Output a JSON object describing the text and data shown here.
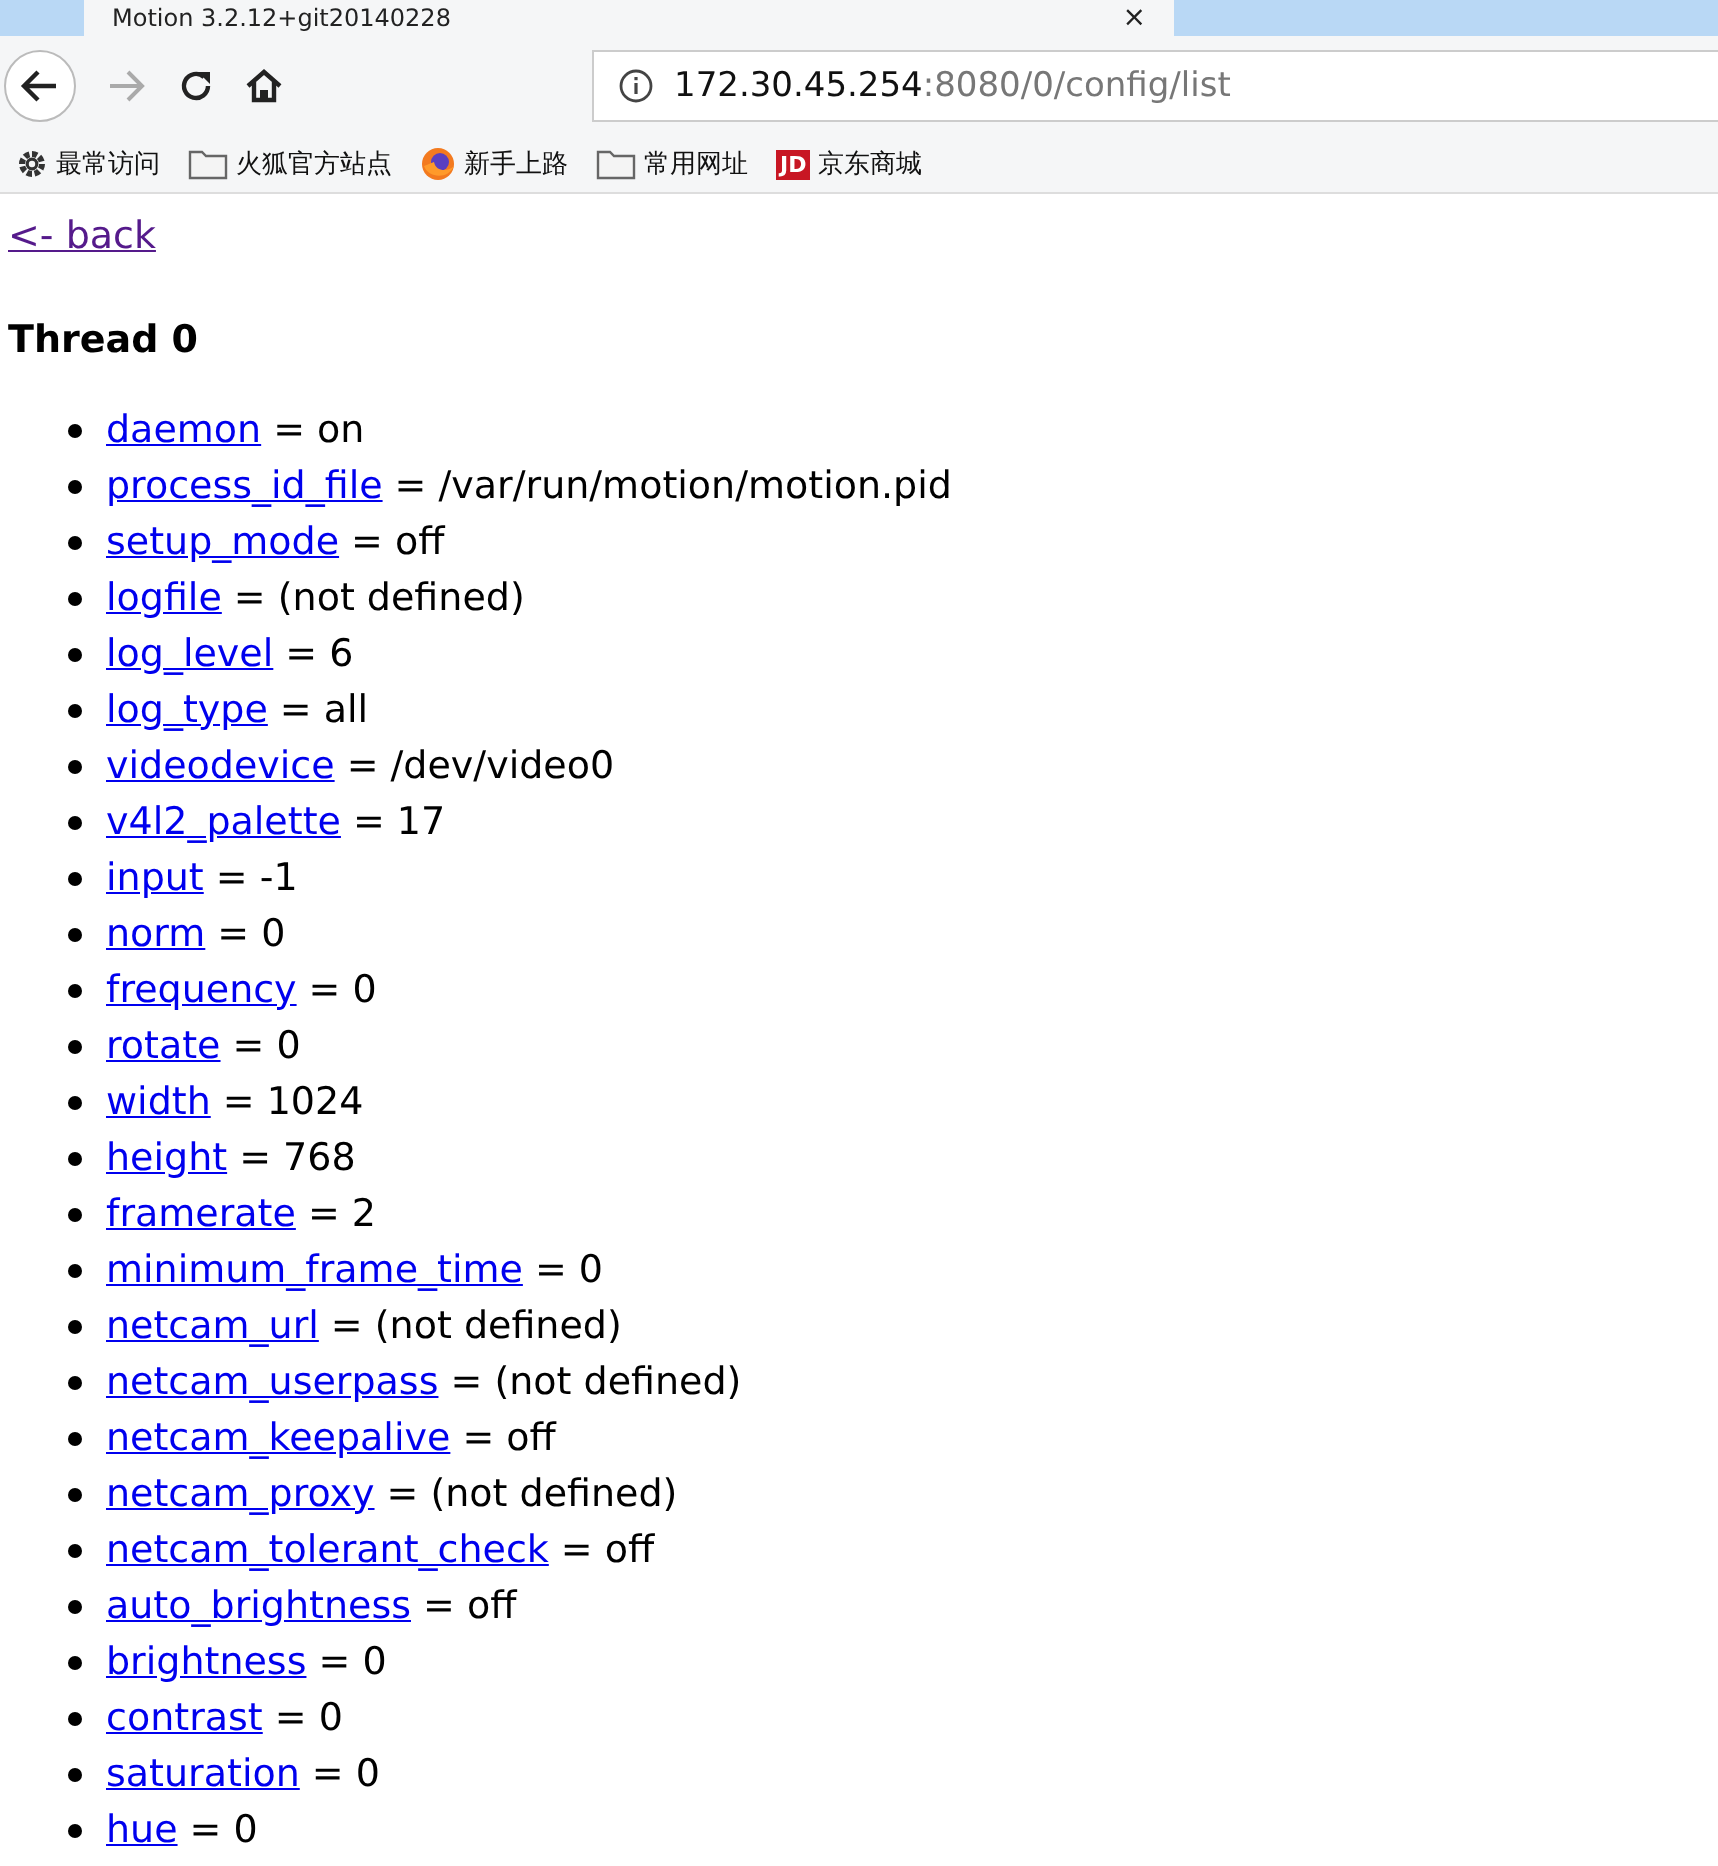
{
  "tab": {
    "title": "Motion 3.2.12+git20140228",
    "close": "×"
  },
  "address": {
    "host": "172.30.45.254",
    "rest": ":8080/0/config/list"
  },
  "bookmarks": [
    {
      "kind": "gear",
      "label": "最常访问"
    },
    {
      "kind": "folder",
      "label": "火狐官方站点"
    },
    {
      "kind": "firefox",
      "label": "新手上路"
    },
    {
      "kind": "folder",
      "label": "常用网址"
    },
    {
      "kind": "jd",
      "label": "京东商城",
      "badge": "JD"
    }
  ],
  "back_link": {
    "text": "<- back",
    "visited": true
  },
  "heading": "Thread 0",
  "settings": [
    {
      "name": "daemon",
      "value": "= on",
      "visited": false
    },
    {
      "name": "process_id_file",
      "value": "= /var/run/motion/motion.pid",
      "visited": false
    },
    {
      "name": "setup_mode",
      "value": "= off",
      "visited": false
    },
    {
      "name": "logfile",
      "value": "= (not defined)",
      "visited": false
    },
    {
      "name": "log_level",
      "value": "= 6",
      "visited": false
    },
    {
      "name": "log_type",
      "value": "= all",
      "visited": false
    },
    {
      "name": "videodevice",
      "value": "= /dev/video0",
      "visited": false
    },
    {
      "name": "v4l2_palette",
      "value": "= 17",
      "visited": false
    },
    {
      "name": "input",
      "value": "= -1",
      "visited": false
    },
    {
      "name": "norm",
      "value": "= 0",
      "visited": false
    },
    {
      "name": "frequency",
      "value": "= 0",
      "visited": false
    },
    {
      "name": "rotate",
      "value": "= 0",
      "visited": false
    },
    {
      "name": "width",
      "value": "= 1024",
      "visited": false
    },
    {
      "name": "height",
      "value": "= 768",
      "visited": false
    },
    {
      "name": "framerate",
      "value": "= 2",
      "visited": false
    },
    {
      "name": "minimum_frame_time",
      "value": "= 0",
      "visited": false
    },
    {
      "name": "netcam_url",
      "value": "= (not defined)",
      "visited": false
    },
    {
      "name": "netcam_userpass",
      "value": "= (not defined)",
      "visited": false
    },
    {
      "name": "netcam_keepalive",
      "value": "= off",
      "visited": false
    },
    {
      "name": "netcam_proxy",
      "value": "= (not defined)",
      "visited": false
    },
    {
      "name": "netcam_tolerant_check",
      "value": "= off",
      "visited": false
    },
    {
      "name": "auto_brightness",
      "value": "= off",
      "visited": false
    },
    {
      "name": "brightness",
      "value": "= 0",
      "visited": false
    },
    {
      "name": "contrast",
      "value": "= 0",
      "visited": false
    },
    {
      "name": "saturation",
      "value": "= 0",
      "visited": false
    },
    {
      "name": "hue",
      "value": "= 0",
      "visited": false
    }
  ]
}
